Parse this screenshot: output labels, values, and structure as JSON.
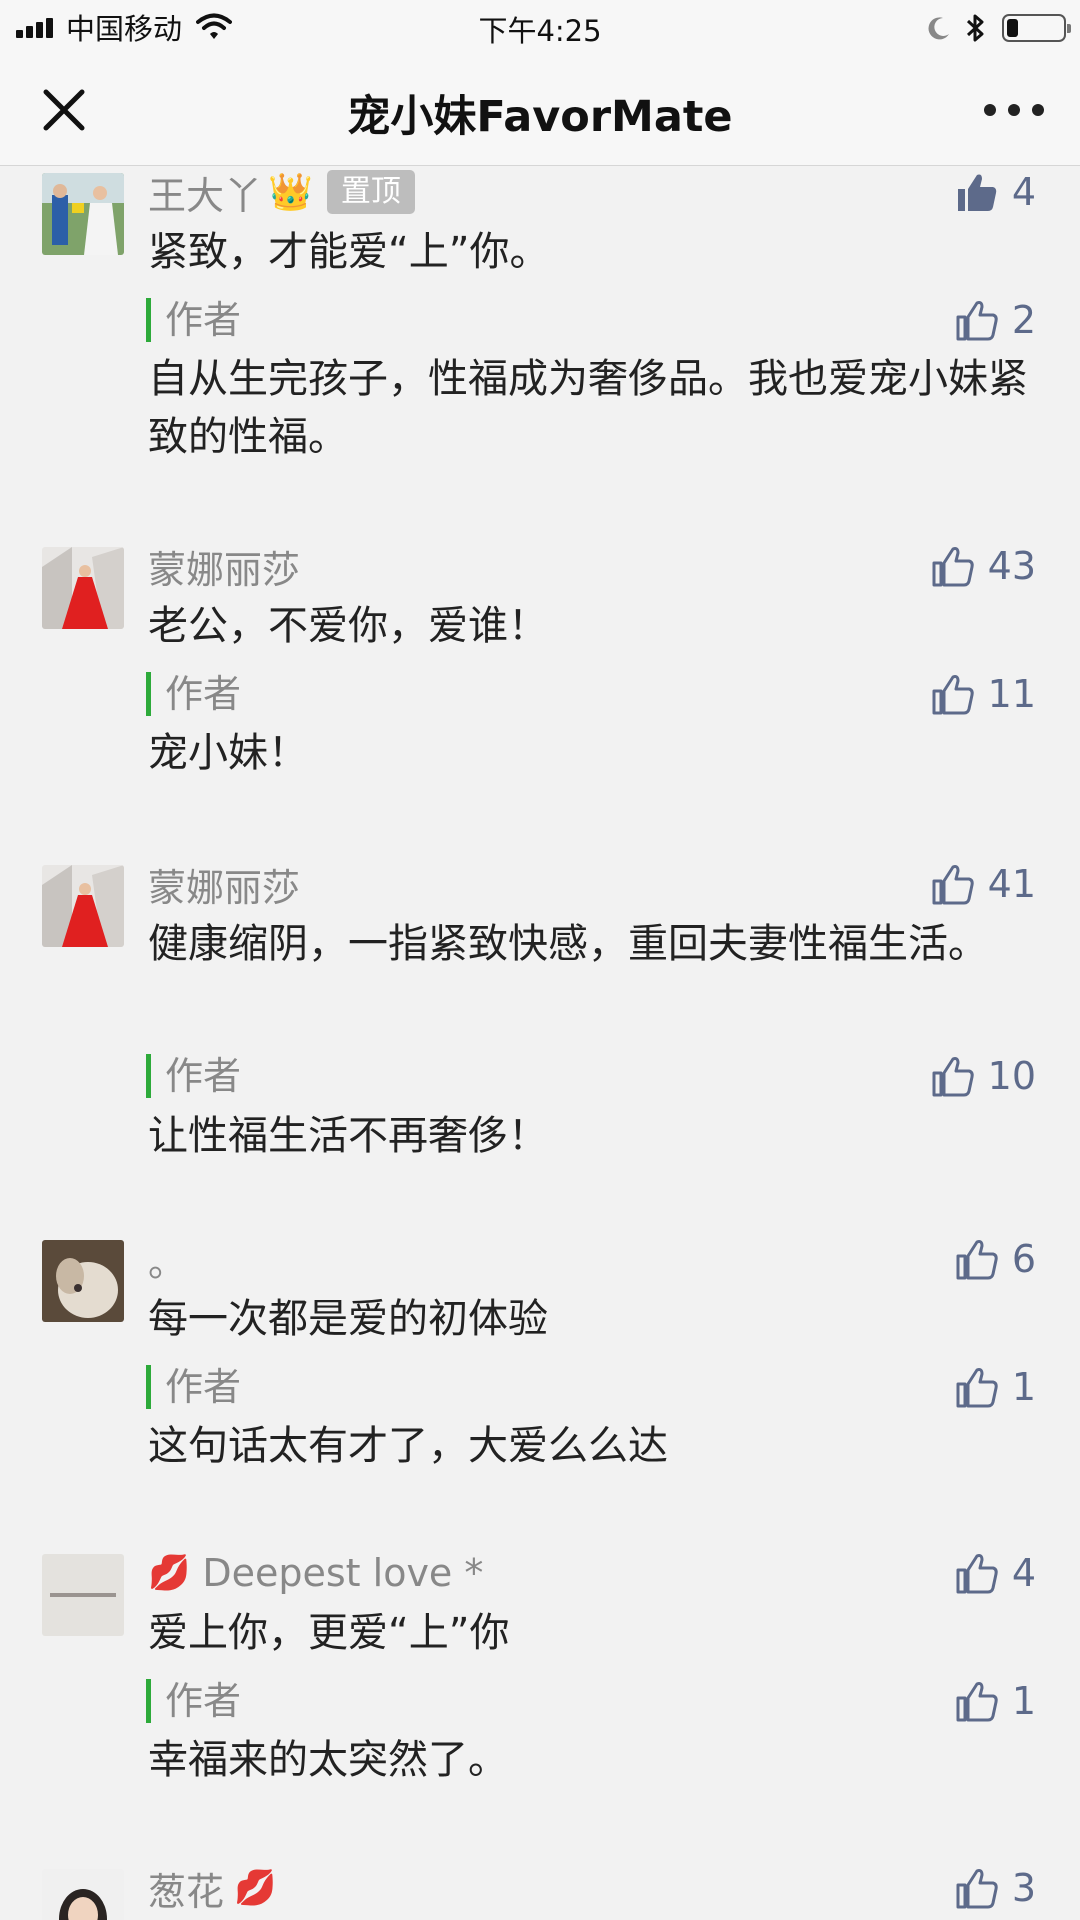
{
  "status": {
    "carrier": "中国移动",
    "time": "下午4:25",
    "battery_level": 0.2
  },
  "nav": {
    "title": "宠小妹FavorMate",
    "close_icon": "close-icon",
    "more_icon": "more-icon"
  },
  "comments": [
    {
      "nickname": "王大丫",
      "badge": "👑",
      "pin_label": "置顶",
      "likes": "4",
      "liked": true,
      "text": "紧致，才能爱“上”你。",
      "reply": {
        "author_label": "作者",
        "likes": "2",
        "text": "自从生完孩子，性福成为奢侈品。我也爱宠小妹紧致的性福。"
      }
    },
    {
      "nickname": "蒙娜丽莎",
      "likes": "43",
      "text": "老公，不爱你，爱谁！",
      "reply": {
        "author_label": "作者",
        "likes": "11",
        "text": "宠小妹！"
      }
    },
    {
      "nickname": "蒙娜丽莎",
      "likes": "41",
      "text": "健康缩阴，一指紧致快感，重回夫妻性福生活。",
      "reply": {
        "author_label": "作者",
        "likes": "10",
        "text": "让性福生活不再奢侈！"
      }
    },
    {
      "nickname": "。",
      "likes": "6",
      "text": "每一次都是爱的初体验",
      "reply": {
        "author_label": "作者",
        "likes": "1",
        "text": "这句话太有才了，大爱么么达"
      }
    },
    {
      "nickname": "Deepest love *",
      "lips": "💋",
      "likes": "4",
      "text": "爱上你，更爱“上”你",
      "reply": {
        "author_label": "作者",
        "likes": "1",
        "text": "幸福来的太突然了。"
      }
    },
    {
      "nickname": "葱花",
      "lips": "💋",
      "likes": "3"
    }
  ]
}
